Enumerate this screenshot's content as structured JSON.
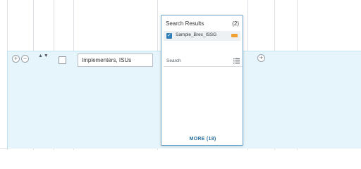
{
  "row": {
    "value": "Implementers, ISUs",
    "sort_arrows": "▲▼",
    "add_symbol": "+",
    "remove_symbol": "−"
  },
  "popover": {
    "title": "Search Results",
    "count": "(2)",
    "results": [
      {
        "label": "Sample_Brex_ISSG",
        "checked": true
      }
    ],
    "search_placeholder": "Search",
    "more_label": "MORE (18)"
  },
  "colors": {
    "accent": "#2f7fb8",
    "row_highlight": "#e6f5fb",
    "tag": "#f0a030",
    "link": "#2a6f9c"
  },
  "icons": {
    "add": "plus-circle-icon",
    "remove": "minus-circle-icon",
    "sort": "sort-arrows-icon",
    "check": "checkmark-icon",
    "list": "list-icon",
    "tag": "tag-icon"
  }
}
